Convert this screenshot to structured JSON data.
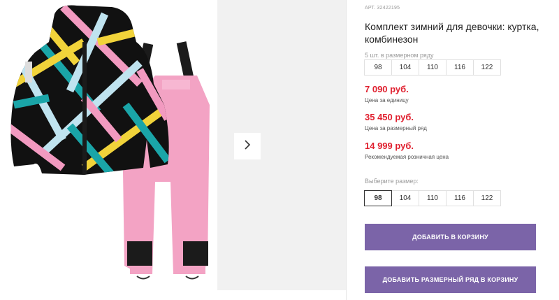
{
  "product": {
    "article": "АРТ. 32422195",
    "title": "Комплект зимний для девочки: куртка, комбинезон"
  },
  "size_row": {
    "label": "5 шт. в размерном ряду",
    "sizes": [
      "98",
      "104",
      "110",
      "116",
      "122"
    ]
  },
  "prices": {
    "unit": {
      "value": "7 090 руб.",
      "note": "Цена за единицу"
    },
    "row": {
      "value": "35 450 руб.",
      "note": "Цена за размерный ряд"
    },
    "retail": {
      "value": "14 999 руб.",
      "note": "Рекомендуемая розничная цена"
    }
  },
  "size_select": {
    "label": "Выберите размер:",
    "sizes": [
      "98",
      "104",
      "110",
      "116",
      "122"
    ],
    "selected": "98"
  },
  "buttons": {
    "add_to_cart": "ДОБАВИТЬ В КОРЗИНУ",
    "add_row_to_cart": "ДОБАВИТЬ РАЗМЕРНЫЙ РЯД В КОРЗИНУ"
  },
  "colors": {
    "price": "#e0202f",
    "button": "#7b64a8",
    "jacket_base": "#111111",
    "jacket_pink": "#f29ac0",
    "jacket_yellow": "#f1d33a",
    "jacket_teal": "#1aa5a8",
    "jacket_lightblue": "#bfe3ef",
    "overalls_pink": "#f3a3c4"
  },
  "icons": {
    "next": "chevron-right-icon"
  }
}
